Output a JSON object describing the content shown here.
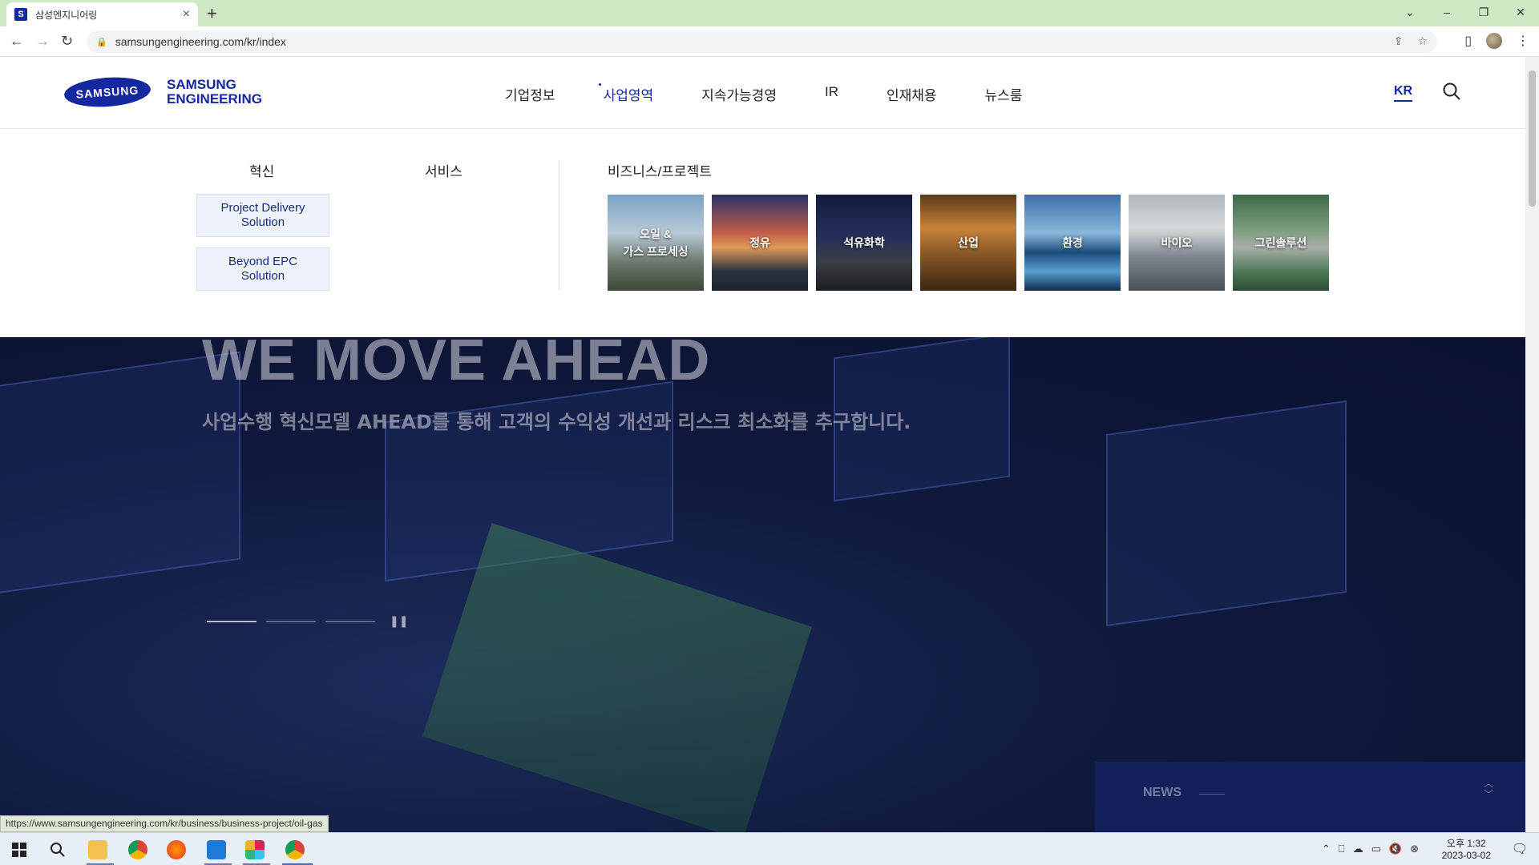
{
  "browser": {
    "tab_title": "삼성엔지니어링",
    "favicon_letter": "S",
    "url": "samsungengineering.com/kr/index",
    "status_url": "https://www.samsungengineering.com/kr/business/business-project/oil-gas"
  },
  "header": {
    "logo_oval_text": "SAMSUNG",
    "logo_line1": "SAMSUNG",
    "logo_line2": "ENGINEERING",
    "nav": [
      "기업정보",
      "사업영역",
      "지속가능경영",
      "IR",
      "인재채용",
      "뉴스룸"
    ],
    "active_nav_index": 1,
    "lang": "KR"
  },
  "mega_menu": {
    "col_innovation": "혁신",
    "col_service": "서비스",
    "col_business": "비즈니스/프로젝트",
    "innovation_items": [
      "Project Delivery\nSolution",
      "Beyond EPC\nSolution"
    ],
    "business_items": [
      "오일 &\n가스 프로세싱",
      "정유",
      "석유화학",
      "산업",
      "환경",
      "바이오",
      "그린솔루션"
    ]
  },
  "hero": {
    "title": "WE MOVE AHEAD",
    "subtitle": "사업수행 혁신모델 AHEAD를 통해 고객의 수익성 개선과 리스크 최소화를 추구합니다.",
    "slide_count": 3,
    "active_slide": 0,
    "news_label": "NEWS"
  },
  "taskbar": {
    "time": "오후 1:32",
    "date": "2023-03-02"
  },
  "colors": {
    "brand": "#1428a0",
    "tabstrip": "#cfe8c4"
  }
}
